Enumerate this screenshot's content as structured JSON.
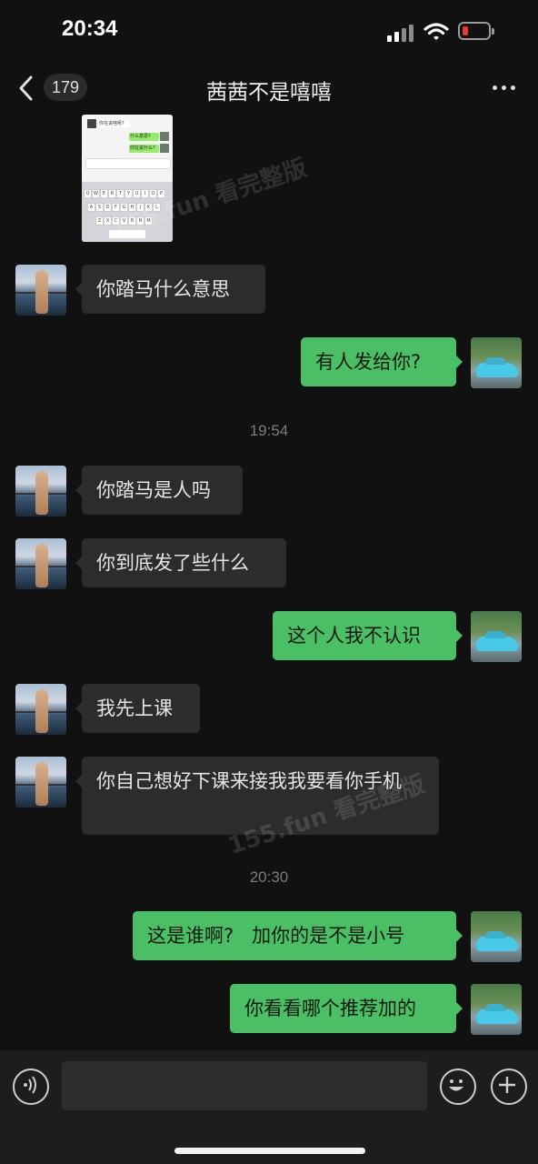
{
  "status_bar": {
    "time": "20:34"
  },
  "nav": {
    "unread_count": "179",
    "chat_title": "茜茜不是嘻嘻"
  },
  "thumbnail": {
    "row1": "你在说啥呢?",
    "row2": "什么意思?",
    "row3": "你在说什么?",
    "watermark": "155.fun 看完整版"
  },
  "messages": [
    {
      "side": "in",
      "text": "你踏马什么意思"
    },
    {
      "side": "out",
      "text": "有人发给你?"
    },
    {
      "type": "time",
      "text": "19:54"
    },
    {
      "side": "in",
      "text": "你踏马是人吗"
    },
    {
      "side": "in",
      "text": "你到底发了些什么"
    },
    {
      "side": "out",
      "text": "这个人我不认识"
    },
    {
      "side": "in",
      "text": "我先上课"
    },
    {
      "side": "in",
      "text": "你自己想好下课来接我我要看你手机"
    },
    {
      "type": "time",
      "text": "20:30"
    },
    {
      "side": "out",
      "text": "这是谁啊?   加你的是不是小号"
    },
    {
      "side": "out",
      "text": "你看看哪个推荐加的"
    }
  ],
  "watermarks": [
    "155.fun 看完整版",
    "155.fun 看完整版"
  ],
  "input": {
    "value": ""
  },
  "icons": [
    "back-arrow-icon",
    "more-dots-icon",
    "voice-icon",
    "emoji-icon",
    "plus-icon"
  ]
}
